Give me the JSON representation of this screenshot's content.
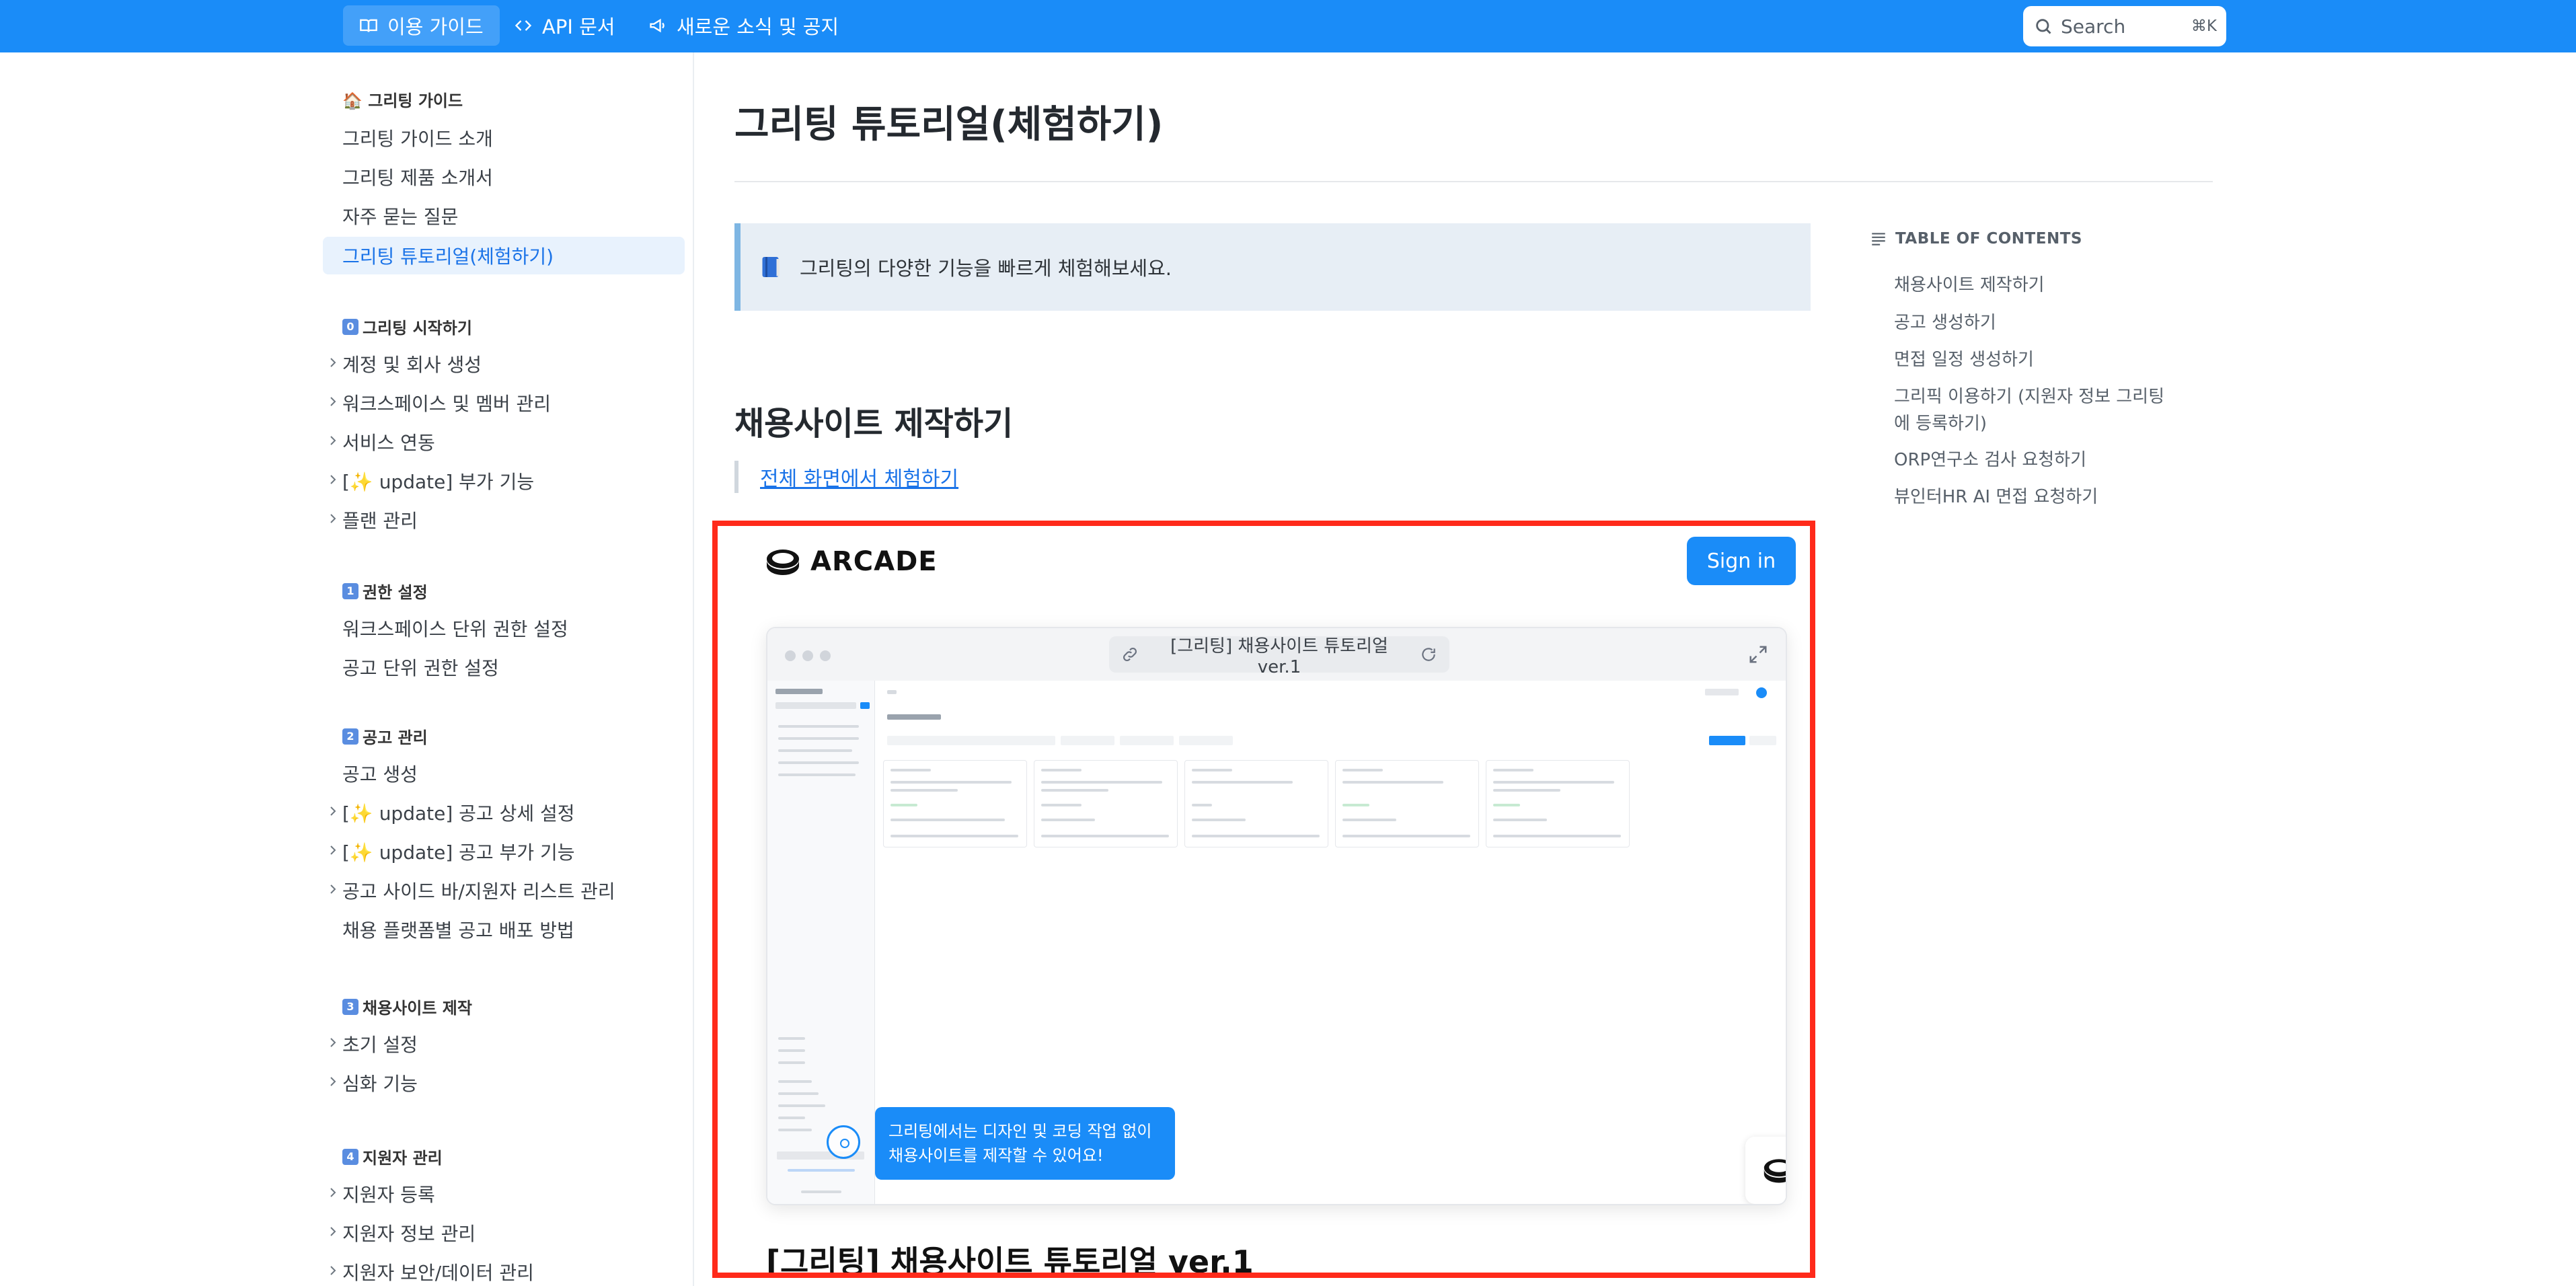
{
  "topbar": {
    "nav": [
      {
        "label": "이용 가이드",
        "icon": "book-icon",
        "active": true
      },
      {
        "label": "API 문서",
        "icon": "code-icon",
        "active": false
      },
      {
        "label": "새로운 소식 및 공지",
        "icon": "megaphone-icon",
        "active": false
      }
    ],
    "search": {
      "placeholder": "Search",
      "shortcut": "⌘K"
    }
  },
  "sidebar": {
    "sections": [
      {
        "title": "🏠 그리팅 가이드",
        "items": [
          {
            "label": "그리팅 가이드 소개",
            "expandable": false
          },
          {
            "label": "그리팅 제품 소개서",
            "expandable": false
          },
          {
            "label": "자주 묻는 질문",
            "expandable": false
          },
          {
            "label": "그리팅 튜토리얼(체험하기)",
            "expandable": false,
            "active": true
          }
        ]
      },
      {
        "badge": "0",
        "title": "그리팅 시작하기",
        "items": [
          {
            "label": "계정 및 회사 생성",
            "expandable": true
          },
          {
            "label": "워크스페이스 및 멤버 관리",
            "expandable": true
          },
          {
            "label": "서비스 연동",
            "expandable": true
          },
          {
            "label": "[✨ update] 부가 기능",
            "expandable": true
          },
          {
            "label": "플랜 관리",
            "expandable": true
          }
        ]
      },
      {
        "badge": "1",
        "title": "권한 설정",
        "items": [
          {
            "label": "워크스페이스 단위 권한 설정",
            "expandable": false
          },
          {
            "label": "공고 단위 권한 설정",
            "expandable": false
          }
        ]
      },
      {
        "badge": "2",
        "title": "공고 관리",
        "items": [
          {
            "label": "공고 생성",
            "expandable": false
          },
          {
            "label": "[✨ update] 공고 상세 설정",
            "expandable": true
          },
          {
            "label": "[✨ update] 공고 부가 기능",
            "expandable": true
          },
          {
            "label": "공고 사이드 바/지원자 리스트 관리",
            "expandable": true
          },
          {
            "label": "채용 플랫폼별 공고 배포 방법",
            "expandable": false
          }
        ]
      },
      {
        "badge": "3",
        "title": "채용사이트 제작",
        "items": [
          {
            "label": "초기 설정",
            "expandable": true
          },
          {
            "label": "심화 기능",
            "expandable": true
          }
        ]
      },
      {
        "badge": "4",
        "title": "지원자 관리",
        "items": [
          {
            "label": "지원자 등록",
            "expandable": true
          },
          {
            "label": "지원자 정보 관리",
            "expandable": true
          },
          {
            "label": "지원자 보안/데이터 관리",
            "expandable": true
          }
        ]
      }
    ]
  },
  "main": {
    "title": "그리팅 튜토리얼(체험하기)",
    "callout": {
      "icon": "blue-book-icon",
      "text": "그리팅의 다양한 기능을 빠르게 체험해보세요."
    },
    "section_title": "채용사이트 제작하기",
    "quote_link": "전체 화면에서 체험하기",
    "embed": {
      "brand": "ARCADE",
      "sign_in": "Sign in",
      "url": "[그리팅] 채용사이트 튜토리얼 ver.1",
      "tooltip_line1": "그리팅에서는 디자인 및 코딩 작업 없이",
      "tooltip_line2": "채용사이트를 제작할 수 있어요!",
      "title": "[그리팅] 채용사이트 튜토리얼 ver.1"
    }
  },
  "toc": {
    "heading": "TABLE OF CONTENTS",
    "items": [
      "채용사이트 제작하기",
      "공고 생성하기",
      "면접 일정 생성하기",
      "그리픽 이용하기 (지원자 정보 그리팅에 등록하기)",
      "ORP연구소 검사 요청하기",
      "뷰인터HR AI 면접 요청하기"
    ]
  },
  "colors": {
    "brand_blue": "#1a8cf8",
    "highlight_red": "#ff2a1a",
    "active_bg": "#e8f2fd"
  }
}
